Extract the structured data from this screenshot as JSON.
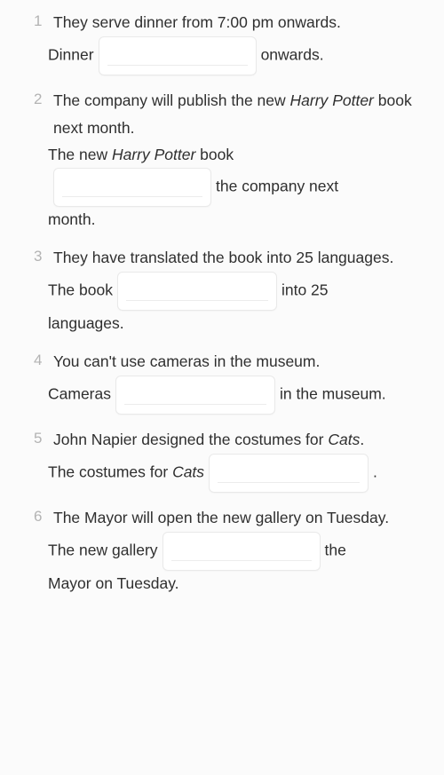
{
  "page": {
    "background_color": "#fbfbfb",
    "text_color": "#2f2f2f",
    "number_color": "#b3b3b3",
    "blank_border_color": "#e9e9e9",
    "blank_fill_color": "#ffffff"
  },
  "exercises": [
    {
      "number": "1",
      "prompt": "They serve dinner from 7:00 pm onwards.",
      "answer_parts": [
        {
          "type": "text",
          "value": "Dinner"
        },
        {
          "type": "blank",
          "value": ""
        },
        {
          "type": "text",
          "value": "onwards."
        }
      ]
    },
    {
      "number": "2",
      "prompt_parts": [
        {
          "type": "text",
          "value": "The company will publish the new "
        },
        {
          "type": "italic",
          "value": "Harry Potter"
        },
        {
          "type": "text",
          "value": " book next month."
        }
      ],
      "prompt": "The company will publish the new Harry Potter book next month.",
      "answer_parts": [
        {
          "type": "text",
          "value": "The new "
        },
        {
          "type": "italic",
          "value": "Harry Potter"
        },
        {
          "type": "text",
          "value": " book"
        },
        {
          "type": "blank",
          "value": ""
        },
        {
          "type": "text",
          "value": "the company next month."
        }
      ]
    },
    {
      "number": "3",
      "prompt": "They have translated the book into 25 languages.",
      "answer_parts": [
        {
          "type": "text",
          "value": "The book"
        },
        {
          "type": "blank",
          "value": ""
        },
        {
          "type": "text",
          "value": "into 25 languages."
        }
      ]
    },
    {
      "number": "4",
      "prompt": "You can't use cameras in the museum.",
      "answer_parts": [
        {
          "type": "text",
          "value": "Cameras"
        },
        {
          "type": "blank",
          "value": ""
        },
        {
          "type": "text",
          "value": "in the museum."
        }
      ]
    },
    {
      "number": "5",
      "prompt_parts": [
        {
          "type": "text",
          "value": "John Napier designed the costumes for "
        },
        {
          "type": "italic",
          "value": "Cats"
        },
        {
          "type": "text",
          "value": "."
        }
      ],
      "prompt": "John Napier designed the costumes for Cats.",
      "answer_parts": [
        {
          "type": "text",
          "value": "The costumes for "
        },
        {
          "type": "italic",
          "value": "Cats"
        },
        {
          "type": "blank",
          "value": ""
        },
        {
          "type": "text",
          "value": "."
        }
      ]
    },
    {
      "number": "6",
      "prompt": "The Mayor will open the new gallery on Tuesday.",
      "answer_parts": [
        {
          "type": "text",
          "value": "The new gallery"
        },
        {
          "type": "blank",
          "value": ""
        },
        {
          "type": "text",
          "value": "the Mayor on Tuesday."
        }
      ]
    }
  ],
  "ex1": {
    "number": "1",
    "prompt": "They serve dinner from 7:00 pm onwards.",
    "a1": "Dinner",
    "a2": "onwards."
  },
  "ex2": {
    "number": "2",
    "p1": "The company will publish the new ",
    "p2": "Harry",
    "p3": " ",
    "p4": "Potter",
    "p5": " book next month.",
    "a1": "The new ",
    "a2": "Harry Potter",
    "a3": " book",
    "a4": "the company next",
    "a5": "month."
  },
  "ex3": {
    "number": "3",
    "prompt": "They have translated the book into 25 languages.",
    "a1": "The book",
    "a2": "into 25",
    "a3": "languages."
  },
  "ex4": {
    "number": "4",
    "prompt": "You can't use cameras in the museum.",
    "a1": "Cameras",
    "a2": "in the museum."
  },
  "ex5": {
    "number": "5",
    "p1": "John Napier designed the costumes for ",
    "p2": "Cats",
    "p3": ".",
    "a1": "The costumes for ",
    "a2": "Cats",
    "a3": "."
  },
  "ex6": {
    "number": "6",
    "prompt": "The Mayor will open the new gallery on Tuesday.",
    "a1": "The new gallery",
    "a2": "the",
    "a3": "Mayor on Tuesday."
  }
}
